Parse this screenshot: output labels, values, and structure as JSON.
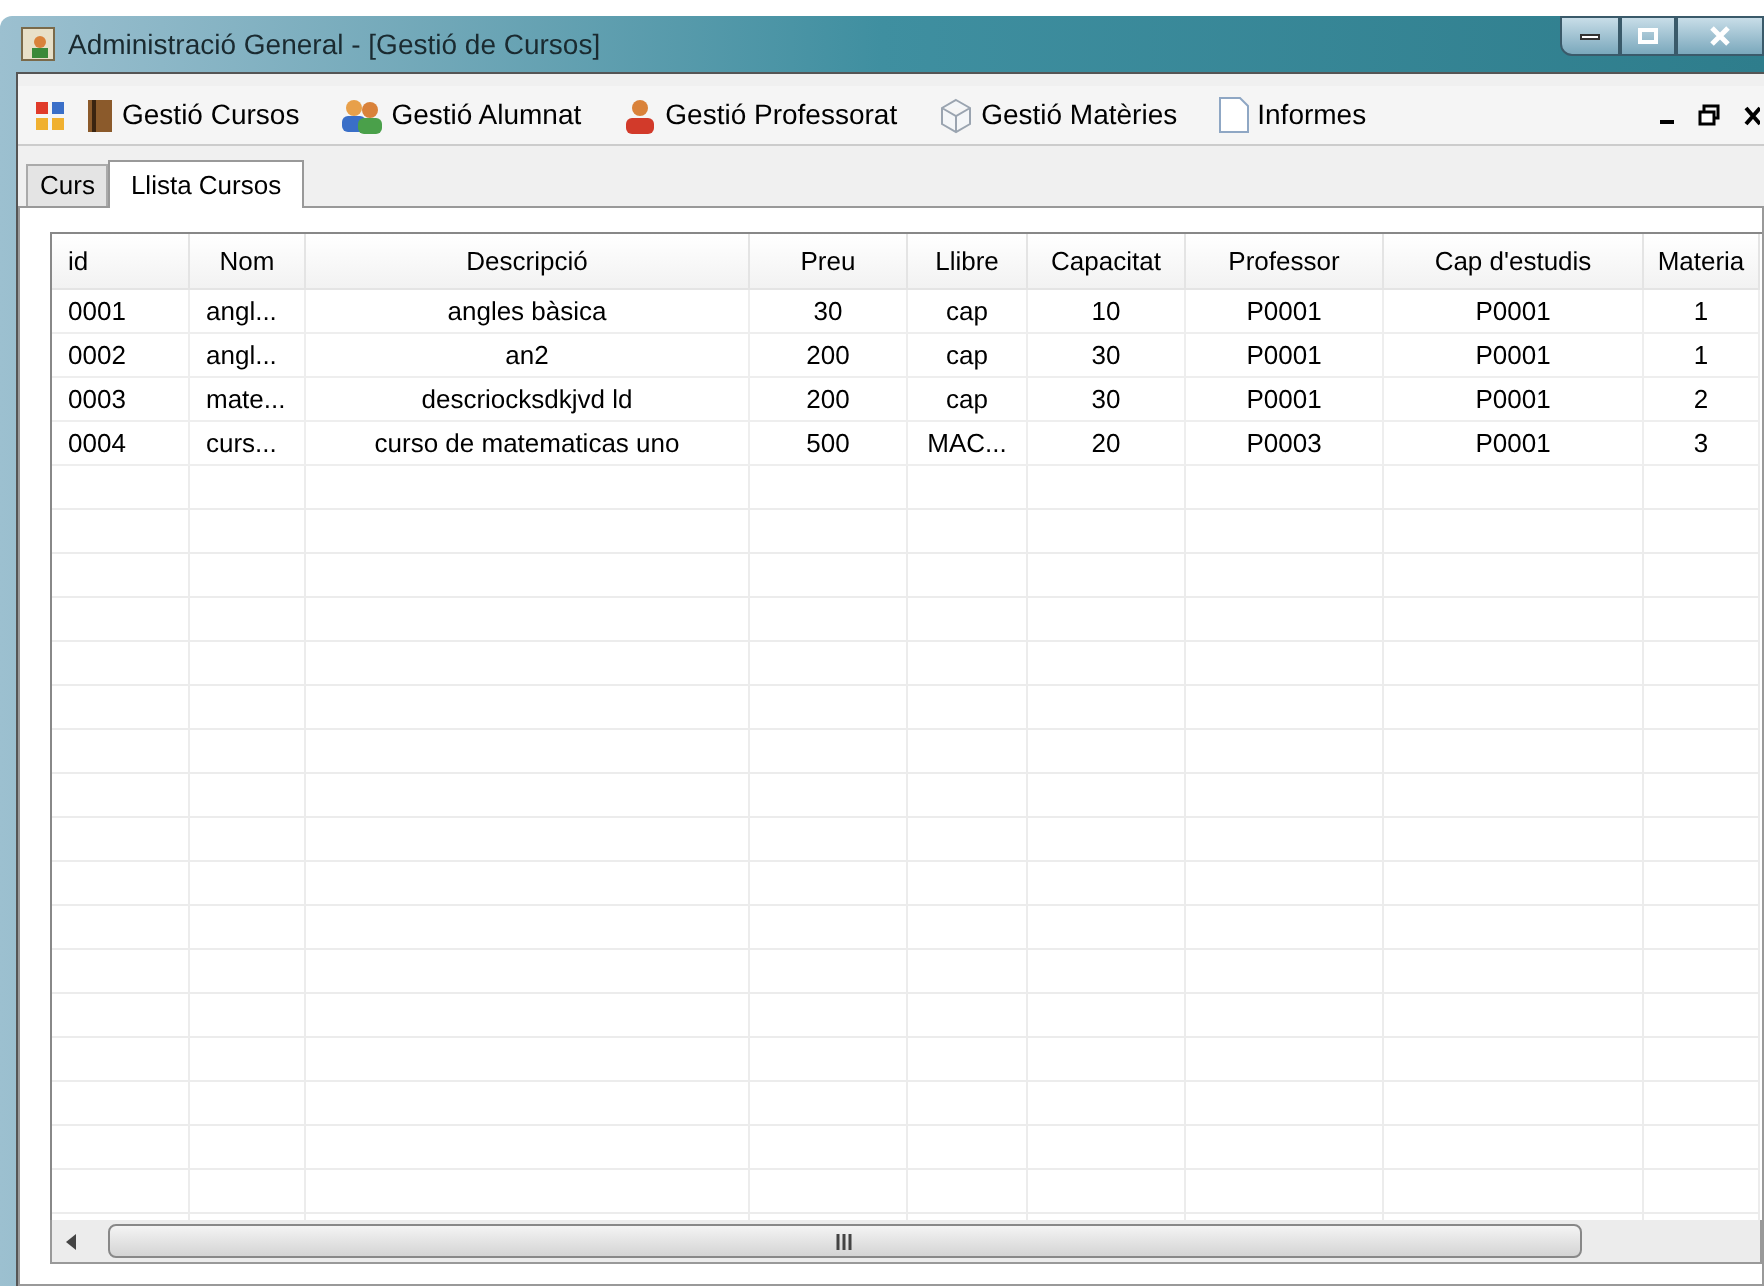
{
  "window": {
    "title": "Administració General - [Gestió de Cursos]"
  },
  "menu": [
    {
      "label": "Gestió Cursos",
      "kind": "book"
    },
    {
      "label": "Gestió Alumnat",
      "kind": "people"
    },
    {
      "label": "Gestió Professorat",
      "kind": "person"
    },
    {
      "label": "Gestió Matèries",
      "kind": "cube"
    },
    {
      "label": "Informes",
      "kind": "page"
    }
  ],
  "tabs": [
    {
      "label": "Curs",
      "selected": false
    },
    {
      "label": "Llista Cursos",
      "selected": true
    }
  ],
  "table": {
    "columns": [
      "id",
      "Nom",
      "Descripció",
      "Preu",
      "Llibre",
      "Capacitat",
      "Professor",
      "Cap d'estudis",
      "Materia"
    ],
    "rows": [
      [
        "0001",
        "angl...",
        "angles bàsica",
        "30",
        "cap",
        "10",
        "P0001",
        "P0001",
        "1"
      ],
      [
        "0002",
        "angl...",
        "an2",
        "200",
        "cap",
        "30",
        "P0001",
        "P0001",
        "1"
      ],
      [
        "0003",
        "mate...",
        "descriocksdkjvd ld",
        "200",
        "cap",
        "30",
        "P0001",
        "P0001",
        "2"
      ],
      [
        "0004",
        "curs...",
        "curso de matematicas uno",
        "500",
        "MAC...",
        "20",
        "P0003",
        "P0001",
        "3"
      ]
    ]
  }
}
